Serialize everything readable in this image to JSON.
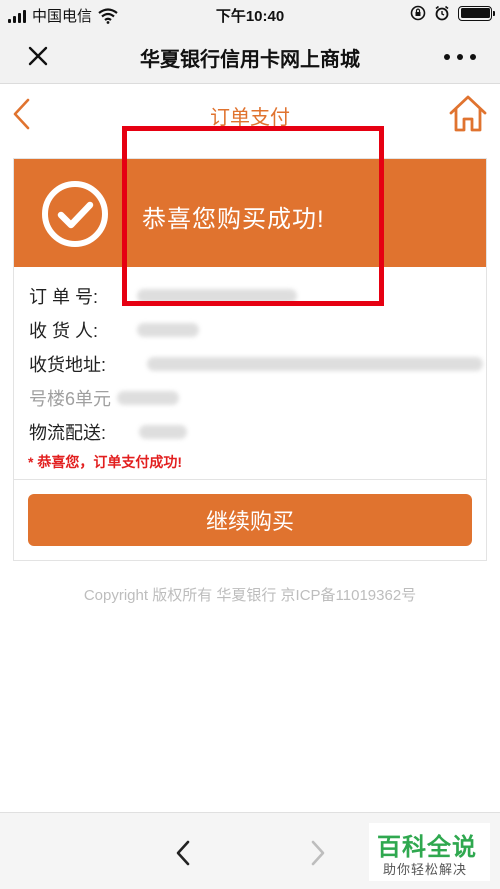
{
  "status_bar": {
    "carrier": "中国电信",
    "time": "下午10:40",
    "battery_level": 1.0
  },
  "nav_bar": {
    "title": "华夏银行信用卡网上商城",
    "close_icon": "close-icon",
    "more_icon": "more-dots-icon"
  },
  "page_header": {
    "title": "订单支付",
    "back_icon": "chevron-left-icon",
    "home_icon": "home-icon",
    "accent_color": "#e0732f"
  },
  "banner": {
    "message": "恭喜您购买成功!",
    "icon": "check-circle-icon",
    "background_color": "#e0732f"
  },
  "order_info": {
    "order_no_label": "订 单 号:",
    "receiver_label": "收 货 人:",
    "address_label": "收货地址:",
    "address_line2": "号楼6单元",
    "delivery_label": "物流配送:"
  },
  "success_note": "* 恭喜您，订单支付成功!",
  "continue_button": "继续购买",
  "copyright": "Copyright 版权所有 华夏银行 京ICP备11019362号",
  "bottom_bar": {
    "prev_icon": "chevron-left-icon",
    "next_icon": "chevron-right-icon"
  },
  "watermark": {
    "title": "百科全说",
    "subtitle": "助你轻松解决"
  }
}
